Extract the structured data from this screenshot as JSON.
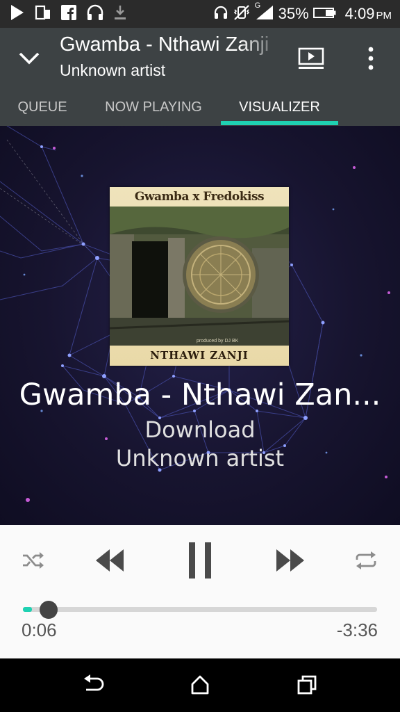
{
  "status_bar": {
    "battery": "35%",
    "time": "4:09",
    "ampm": "PM",
    "network": "G",
    "icons": [
      "play-store-icon",
      "tablet-icon",
      "facebook-icon",
      "headphones-icon",
      "download-icon",
      "headset-icon",
      "vibrate-mute-icon",
      "signal-icon",
      "battery-icon"
    ]
  },
  "header": {
    "title": "Gwamba - Nthawi Zanji",
    "subtitle": "Unknown artist"
  },
  "tabs": [
    {
      "label": "QUEUE"
    },
    {
      "label": "NOW PLAYING"
    },
    {
      "label": "VISUALIZER"
    }
  ],
  "active_tab": "VISUALIZER",
  "album_art": {
    "top_text": "Gwamba x Fredokiss",
    "bottom_text": "NTHAWI ZANJI",
    "credit": "produced by DJ BK"
  },
  "visualizer": {
    "title": "Gwamba - Nthawi Zan...",
    "line2": "Download",
    "line3": "Unknown artist"
  },
  "player": {
    "elapsed": "0:06",
    "remaining": "-3:36",
    "progress": 0.025,
    "state": "playing"
  },
  "colors": {
    "accent": "#1fd1b2",
    "header_bg": "#3d4244",
    "status_bg": "#2b2b2b",
    "viz_bg": "#17142f",
    "controls_bg": "#fafafa"
  }
}
